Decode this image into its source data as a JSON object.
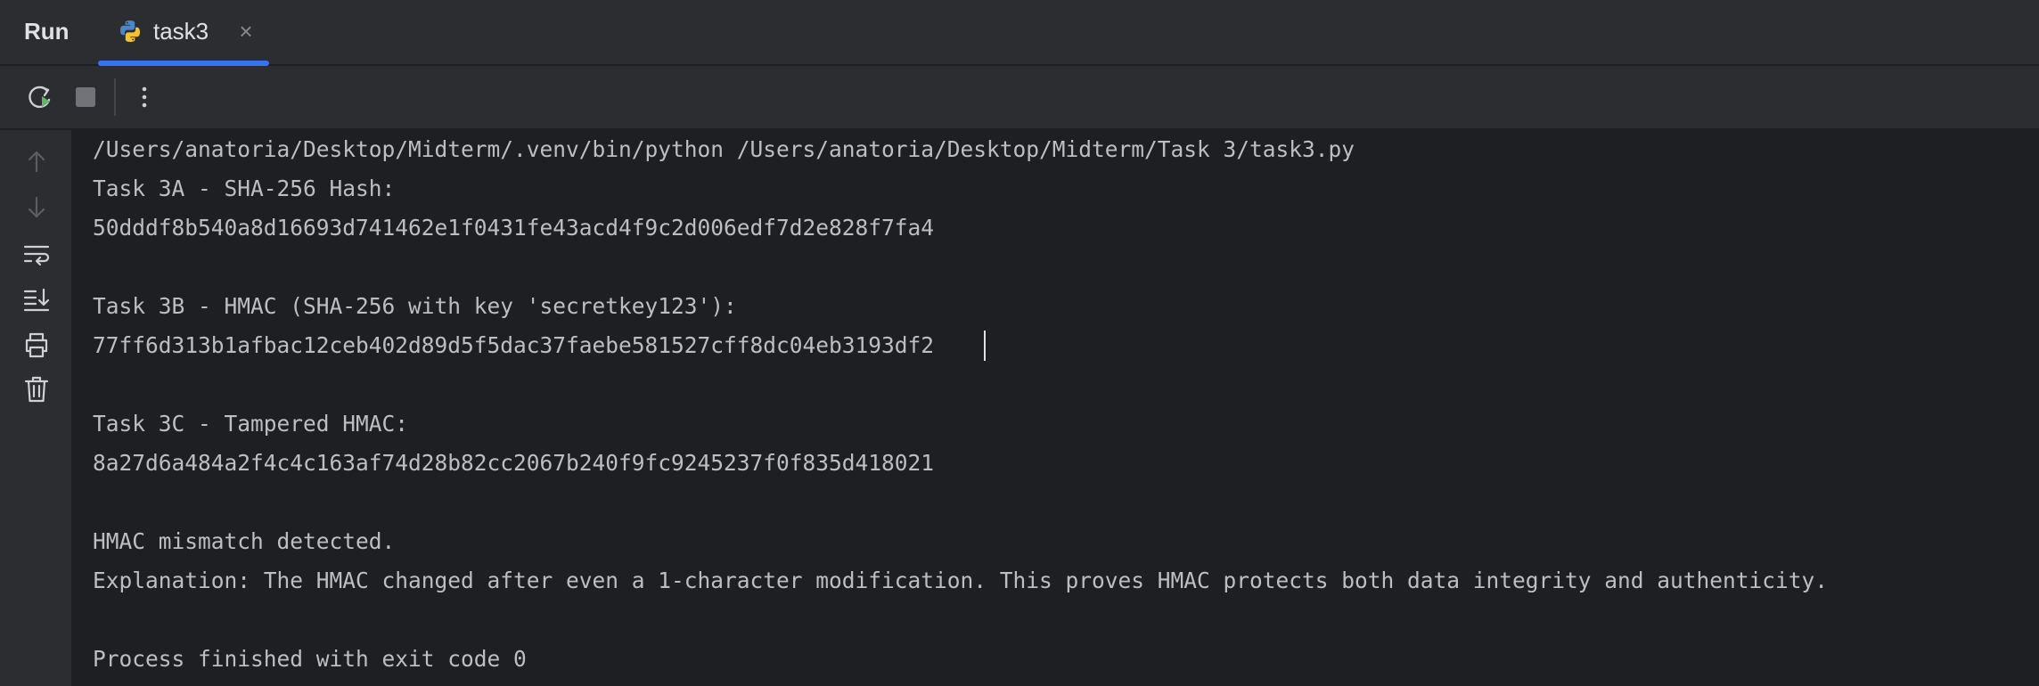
{
  "header": {
    "run_label": "Run",
    "tab": {
      "label": "task3",
      "close_glyph": "×",
      "icon": "python-icon"
    }
  },
  "toolbar": {
    "buttons": [
      "rerun-icon",
      "stop-icon",
      "more-options-icon"
    ],
    "more_glyph": "⋮"
  },
  "gutter": {
    "buttons": [
      "arrow-up-icon",
      "arrow-down-icon",
      "soft-wrap-icon",
      "scroll-to-end-icon",
      "print-icon",
      "trash-icon"
    ]
  },
  "console": {
    "lines": [
      "/Users/anatoria/Desktop/Midterm/.venv/bin/python /Users/anatoria/Desktop/Midterm/Task 3/task3.py",
      "Task 3A - SHA-256 Hash:",
      "50dddf8b540a8d16693d741462e1f0431fe43acd4f9c2d006edf7d2e828f7fa4",
      "",
      "Task 3B - HMAC (SHA-256 with key 'secretkey123'):",
      "77ff6d313b1afbac12ceb402d89d5f5dac37faebe581527cff8dc04eb3193df2",
      "",
      "Task 3C - Tampered HMAC:",
      "8a27d6a484a2f4c4c163af74d28b82cc2067b240f9fc9245237f0f835d418021",
      "",
      "HMAC mismatch detected.",
      "Explanation: The HMAC changed after even a 1-character modification. This proves HMAC protects both data integrity and authenticity.",
      "",
      "Process finished with exit code 0"
    ]
  },
  "colors": {
    "background": "#1e1f22",
    "panel": "#2b2d30",
    "text": "#bcbec4",
    "accent": "#3574f0",
    "rerun_green": "#5fb865"
  }
}
